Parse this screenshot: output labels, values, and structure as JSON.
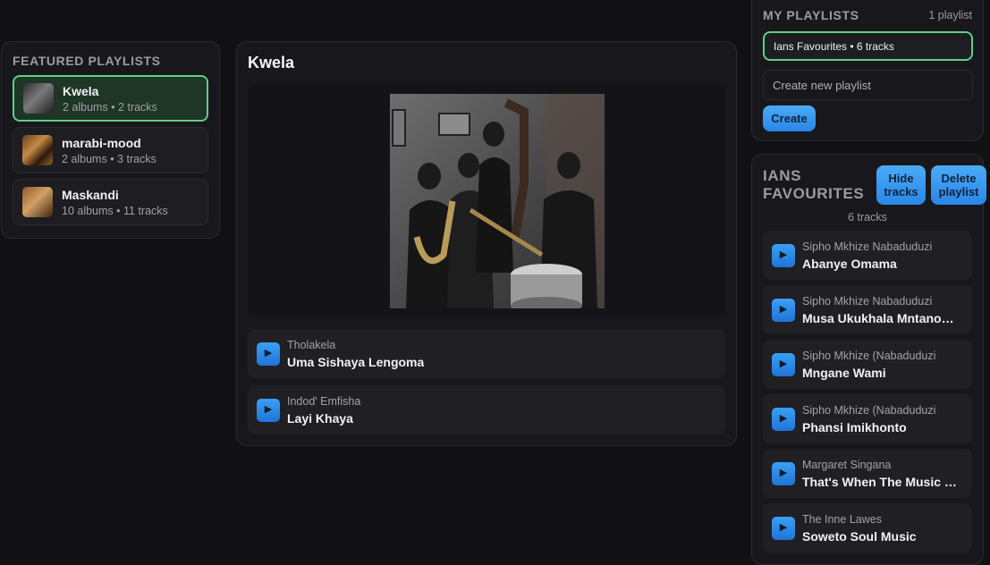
{
  "featured": {
    "title": "FEATURED PLAYLISTS",
    "items": [
      {
        "name": "Kwela",
        "meta": "2 albums • 2 tracks"
      },
      {
        "name": "marabi-mood",
        "meta": "2 albums • 3 tracks"
      },
      {
        "name": "Maskandi",
        "meta": "10 albums • 11 tracks"
      }
    ]
  },
  "center": {
    "title": "Kwela",
    "tracks": [
      {
        "artist": "Tholakela",
        "title": "Uma Sishaya Lengoma"
      },
      {
        "artist": "Indod' Emfisha",
        "title": "Layi Khaya"
      }
    ]
  },
  "my_playlists": {
    "title": "MY PLAYLISTS",
    "count": "1 playlist",
    "selected": "Ians Favourites • 6 tracks",
    "new_placeholder": "Create new playlist",
    "create_label": "Create"
  },
  "detail": {
    "title": "IANS FAVOURITES",
    "hide_label": "Hide tracks",
    "delete_label": "Delete playlist",
    "count": "6 tracks",
    "tracks": [
      {
        "artist": "Sipho Mkhize Nabaduduzi",
        "title": "Abanye Omama"
      },
      {
        "artist": "Sipho Mkhize Nabaduduzi",
        "title": "Musa Ukukhala Mntanomntu"
      },
      {
        "artist": "Sipho Mkhize (Nabaduduzi",
        "title": "Mngane Wami"
      },
      {
        "artist": "Sipho Mkhize (Nabaduduzi",
        "title": "Phansi Imikhonto"
      },
      {
        "artist": "Margaret Singana",
        "title": "That's When The Music Takes Me"
      },
      {
        "artist": "The Inne Lawes",
        "title": "Soweto Soul Music"
      }
    ]
  },
  "icons": {
    "play": "play-icon"
  },
  "colors": {
    "accent_blue": "#2a86e8",
    "active_green": "#5fcf85"
  }
}
